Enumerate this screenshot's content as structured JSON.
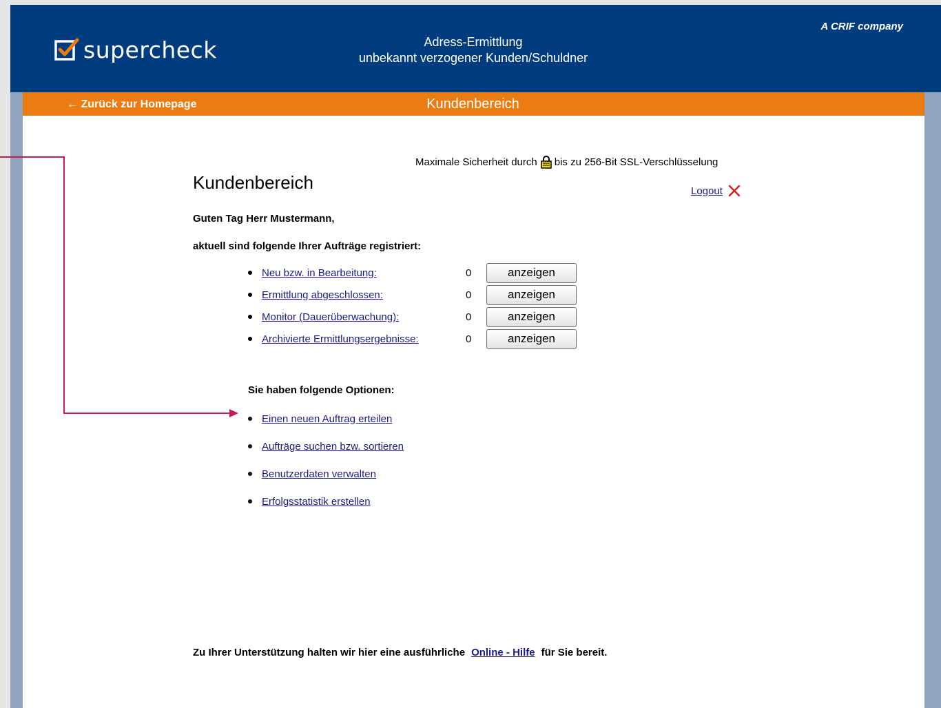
{
  "header": {
    "logo_text": "supercheck",
    "title_line1": "Adress-Ermittlung",
    "title_line2": "unbekannt verzogener Kunden/Schuldner",
    "crif_label": "A CRIF company"
  },
  "nav": {
    "back_link": "← Zurück zur Homepage",
    "bar_title": "Kundenbereich"
  },
  "security": {
    "text_before": "Maximale Sicherheit durch",
    "text_after": "bis zu 256-Bit SSL-Verschlüsselung",
    "icon": "lock-icon"
  },
  "main": {
    "heading": "Kundenbereich",
    "logout_label": "Logout",
    "greeting": "Guten Tag Herr Mustermann,",
    "orders_intro": "aktuell sind folgende Ihrer Aufträge registriert:",
    "orders": [
      {
        "label": "Neu bzw. in Bearbeitung:",
        "count": "0",
        "button": "anzeigen"
      },
      {
        "label": "Ermittlung abgeschlossen:",
        "count": "0",
        "button": "anzeigen"
      },
      {
        "label": "Monitor (Dauerüberwachung):",
        "count": "0",
        "button": "anzeigen"
      },
      {
        "label": "Archivierte Ermittlungsergebnisse:",
        "count": "0",
        "button": "anzeigen"
      }
    ],
    "options_heading": "Sie haben folgende Optionen:",
    "options": [
      "Einen neuen Auftrag erteilen",
      "Aufträge suchen bzw. sortieren",
      "Benutzerdaten verwalten",
      "Erfolgsstatistik erstellen"
    ]
  },
  "support": {
    "text_before": "Zu Ihrer Unterstützung halten wir hier eine ausführliche",
    "link": "Online - Hilfe",
    "text_after": "für Sie bereit."
  },
  "colors": {
    "header_blue": "#003c7e",
    "bar_orange": "#ec7c12",
    "frame_blue": "#8fa5bf",
    "link_blue": "#1a1a8c",
    "annotation": "#cc1a56",
    "logout_x": "#d42020"
  }
}
